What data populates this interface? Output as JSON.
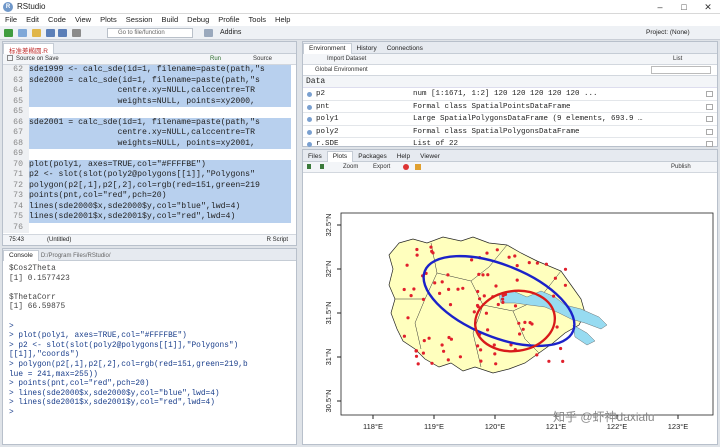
{
  "window": {
    "title": "RStudio",
    "project": "Project: (None)"
  },
  "menu": [
    "File",
    "Edit",
    "Code",
    "View",
    "Plots",
    "Session",
    "Build",
    "Debug",
    "Profile",
    "Tools",
    "Help"
  ],
  "toolbar": {
    "goto_placeholder": "Go to file/function",
    "addins": "Addins"
  },
  "editor": {
    "file_tab": "标准差椭圆.R",
    "source_on_save": "Source on Save",
    "run": "Run",
    "source": "Source",
    "lines": [
      {
        "n": "62",
        "t": "sde1999 <- calc_sde(id=1, filename=paste(path,\"s",
        "sel": true
      },
      {
        "n": "63",
        "t": "sde2000 = calc_sde(id=1, filename=paste(path,\"s",
        "sel": true
      },
      {
        "n": "64",
        "t": "                  centre.xy=NULL,calccentre=TR",
        "sel": true
      },
      {
        "n": "65",
        "t": "                  weights=NULL, points=xy2000,",
        "sel": true
      },
      {
        "n": "65",
        "t": "",
        "sel": true
      },
      {
        "n": "66",
        "t": "sde2001 = calc_sde(id=1, filename=paste(path,\"s",
        "sel": true
      },
      {
        "n": "67",
        "t": "                  centre.xy=NULL,calccentre=TR",
        "sel": true
      },
      {
        "n": "68",
        "t": "                  weights=NULL, points=xy2001,",
        "sel": true
      },
      {
        "n": "69",
        "t": "",
        "sel": true
      },
      {
        "n": "70",
        "t": "plot(poly1, axes=TRUE,col=\"#FFFFBE\")",
        "sel": true
      },
      {
        "n": "71",
        "t": "p2 <- slot(slot(poly2@polygons[[1]],\"Polygons\"",
        "sel": true
      },
      {
        "n": "72",
        "t": "polygon(p2[,1],p2[,2],col=rgb(red=151,green=219",
        "sel": true
      },
      {
        "n": "73",
        "t": "points(pnt,col=\"red\",pch=20)",
        "sel": true
      },
      {
        "n": "74",
        "t": "lines(sde2000$x,sde2000$y,col=\"blue\",lwd=4)",
        "sel": true
      },
      {
        "n": "75",
        "t": "lines(sde2001$x,sde2001$y,col=\"red\",lwd=4)",
        "sel": true
      },
      {
        "n": "76",
        "t": "",
        "sel": false
      }
    ],
    "status_pos": "75:43",
    "status_scope": "(Untitled)",
    "status_type": "R Script"
  },
  "console": {
    "tab": "Console",
    "path": "D:/Program Files/RStudio/",
    "lines": [
      {
        "t": "$Cos2Theta",
        "c": "out"
      },
      {
        "t": "[1] 0.1577423",
        "c": "out"
      },
      {
        "t": "",
        "c": "out"
      },
      {
        "t": "$ThetaCorr",
        "c": "out"
      },
      {
        "t": "[1] 66.59875",
        "c": "out"
      },
      {
        "t": "",
        "c": "out"
      },
      {
        "t": ">",
        "c": "in"
      },
      {
        "t": "> plot(poly1, axes=TRUE,col=\"#FFFFBE\")",
        "c": "in"
      },
      {
        "t": "> p2 <- slot(slot(poly2@polygons[[1]],\"Polygons\")",
        "c": "in"
      },
      {
        "t": "[[1]],\"coords\")",
        "c": "in"
      },
      {
        "t": "> polygon(p2[,1],p2[,2],col=rgb(red=151,green=219,b",
        "c": "in"
      },
      {
        "t": "lue = 241,max=255))",
        "c": "in"
      },
      {
        "t": "> points(pnt,col=\"red\",pch=20)",
        "c": "in"
      },
      {
        "t": "> lines(sde2000$x,sde2000$y,col=\"blue\",lwd=4)",
        "c": "in"
      },
      {
        "t": "> lines(sde2001$x,sde2001$y,col=\"red\",lwd=4)",
        "c": "in"
      },
      {
        "t": ">",
        "c": "in"
      }
    ]
  },
  "environment": {
    "tabs": [
      "Environment",
      "History",
      "Connections"
    ],
    "import": "Import Dataset",
    "list_view": "List",
    "scope": "Global Environment",
    "section": "Data",
    "rows": [
      {
        "name": "p2",
        "value": "num [1:1671, 1:2] 120 120 120 120 120 ..."
      },
      {
        "name": "pnt",
        "value": "Formal class SpatialPointsDataFrame"
      },
      {
        "name": "poly1",
        "value": "Large SpatialPolygonsDataFrame (9 elements, 693.9 …"
      },
      {
        "name": "poly2",
        "value": "Formal class SpatialPolygonsDataFrame"
      },
      {
        "name": "r.SDE",
        "value": "List of 22"
      }
    ]
  },
  "files": {
    "tabs": [
      "Files",
      "Plots",
      "Packages",
      "Help",
      "Viewer"
    ],
    "zoom": "Zoom",
    "export": "Export",
    "publish": "Publish"
  },
  "plot": {
    "poly_fill": "#FFFFBE",
    "water_fill": "#97DBF1",
    "ellipse_2000": "#1b22c9",
    "ellipse_2001": "#d81a1a",
    "xticks": [
      "118°E",
      "119°E",
      "120°E",
      "121°E",
      "122°E",
      "123°E"
    ],
    "yticks": [
      "32.5°N",
      "32°N",
      "31.5°N",
      "31°N",
      "30.5°N"
    ]
  },
  "watermark": "知乎 @虾神daxialu"
}
